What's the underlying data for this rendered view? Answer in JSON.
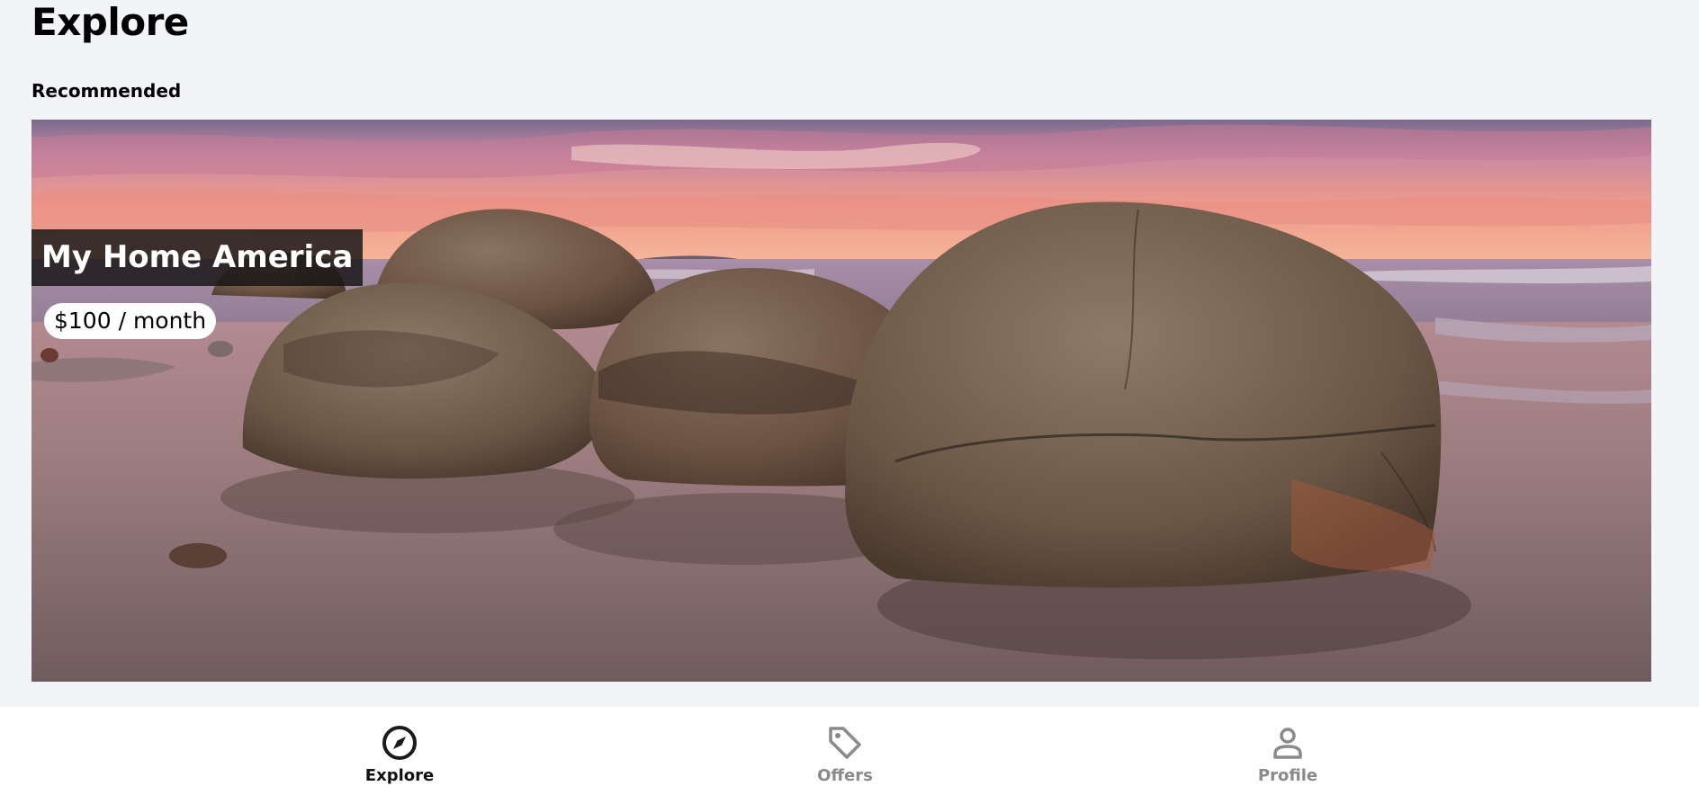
{
  "page": {
    "title": "Explore",
    "section_title": "Recommended"
  },
  "card": {
    "image_alt": "Moeraki boulders on a beach at sunset",
    "title": "My Home America",
    "price": "$100 / month"
  },
  "bottom_nav": {
    "items": [
      {
        "label": "Explore",
        "icon": "compass-icon",
        "active": true
      },
      {
        "label": "Offers",
        "icon": "tag-icon",
        "active": false
      },
      {
        "label": "Profile",
        "icon": "user-icon",
        "active": false
      }
    ]
  },
  "colors": {
    "background": "#f2f4f8",
    "active_nav": "#111111",
    "inactive_nav": "#8a8a8a"
  }
}
